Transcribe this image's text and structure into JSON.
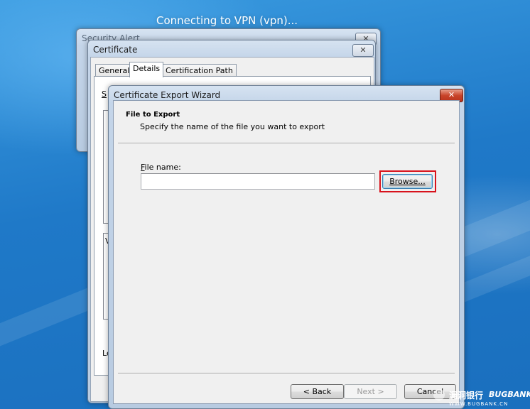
{
  "desktop": {
    "vpn_title": "Connecting to VPN (vpn)..."
  },
  "security_alert": {
    "title": "Security Alert"
  },
  "certificate": {
    "title": "Certificate",
    "tabs": [
      "General",
      "Details",
      "Certification Path"
    ],
    "active_tab": "Details",
    "partial_labels": {
      "show": "S",
      "value_box": "V",
      "learn": "Le"
    }
  },
  "wizard": {
    "title": "Certificate Export Wizard",
    "heading": "File to Export",
    "subheading": "Specify the name of the file you want to export",
    "file_name_label": "File name:",
    "file_name_value": "",
    "browse_label": "Browse...",
    "back_label": "< Back",
    "next_label": "Next >",
    "cancel_label": "Cancel"
  },
  "watermark": {
    "chinese": "漏洞银行",
    "brand": "BUGBANK",
    "url": "WWW.BUGBANK.CN"
  },
  "colors": {
    "desktop_blue": "#1f79c8",
    "highlight_red": "#d8121c",
    "close_red": "#c9442a"
  }
}
